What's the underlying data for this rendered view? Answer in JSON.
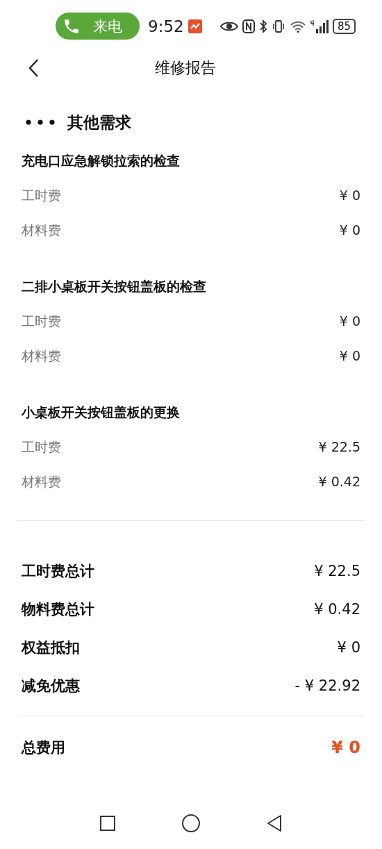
{
  "status_bar": {
    "call_label": "来电",
    "time": "9:52",
    "battery": "85"
  },
  "header": {
    "title": "维修报告"
  },
  "section": {
    "title": "其他需求"
  },
  "items": [
    {
      "name": "充电口应急解锁拉索的检查",
      "fees": [
        {
          "label": "工时费",
          "amount": "¥ 0"
        },
        {
          "label": "材料费",
          "amount": "¥ 0"
        }
      ]
    },
    {
      "name": "二排小桌板开关按钮盖板的检查",
      "fees": [
        {
          "label": "工时费",
          "amount": "¥ 0"
        },
        {
          "label": "材料费",
          "amount": "¥ 0"
        }
      ]
    },
    {
      "name": "小桌板开关按钮盖板的更换",
      "fees": [
        {
          "label": "工时费",
          "amount": "¥ 22.5"
        },
        {
          "label": "材料费",
          "amount": "¥ 0.42"
        }
      ]
    }
  ],
  "summary": [
    {
      "label": "工时费总计",
      "amount": "¥ 22.5"
    },
    {
      "label": "物料费总计",
      "amount": "¥ 0.42"
    },
    {
      "label": "权益抵扣",
      "amount": "¥ 0"
    },
    {
      "label": "减免优惠",
      "amount": "- ¥ 22.92"
    }
  ],
  "total": {
    "label": "总费用",
    "amount": "¥ 0"
  }
}
